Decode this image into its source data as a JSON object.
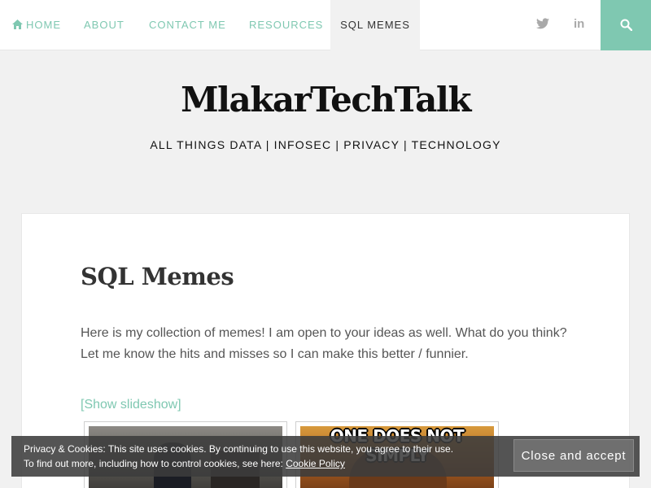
{
  "nav": {
    "home": "HOME",
    "about": "ABOUT",
    "contact": "CONTACT ME",
    "resources": "RESOURCES",
    "sql_memes": "SQL MEMES"
  },
  "social": {
    "twitter": "twitter-icon",
    "linkedin": "linkedin-icon",
    "linkedin_text": "in"
  },
  "site": {
    "title": "MlakarTechTalk",
    "tagline": "ALL THINGS DATA | INFOSEC | PRIVACY | TECHNOLOGY"
  },
  "post": {
    "title": "SQL Memes",
    "intro": "Here is my collection of memes! I am open to your ideas as well. What do you think? Let me know the hits and misses so I can make this better / funnier.",
    "slideshow_link": "[Show slideshow]",
    "gallery": [
      {
        "caption": ""
      },
      {
        "caption": "ONE DOES NOT SIMPLY"
      }
    ]
  },
  "cookie": {
    "line1": "Privacy & Cookies: This site uses cookies. By continuing to use this website, you agree to their use.",
    "line2_prefix": "To find out more, including how to control cookies, see here: ",
    "line2_link": "Cookie Policy",
    "button": "Close and accept"
  },
  "colors": {
    "accent": "#7fc8b1",
    "nav_active_bg": "#f1f1f1",
    "page_bg": "#f1f1f1"
  }
}
